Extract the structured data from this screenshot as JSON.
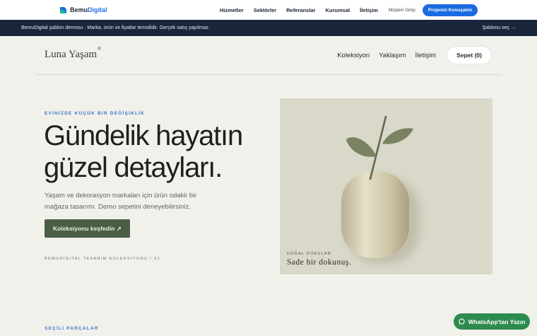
{
  "agency": {
    "logo_main": "Bemu",
    "logo_accent": "Digital",
    "nav": [
      "Hizmetler",
      "Sektörler",
      "Referanslar",
      "Kurumsal",
      "İletişim"
    ],
    "login": "Müşteri Girişi",
    "cta": "Projenizi Konuşalım",
    "brand_color": "#1a6be0"
  },
  "demo_bar": {
    "notice": "BemuDigital şablon demosu · Marka, ürün ve fiyatlar temsilidir. Gerçek satış yapılmaz.",
    "select_template": "Şablonu seç →"
  },
  "store": {
    "logo": "Luna Yaşam",
    "registered": "®",
    "nav": [
      "Koleksiyon",
      "Yaklaşım",
      "İletişim"
    ],
    "cart": "Sepet (0)"
  },
  "hero": {
    "eyebrow": "EVİNİZDE KÜÇÜK BİR DEĞİŞİKLİK",
    "title": "Gündelik hayatın güzel detayları.",
    "text": "Yaşam ve dekorasyon markaları için ürün odaklı bir mağaza tasarımı. Demo sepetini deneyebilirsiniz.",
    "button": "Koleksiyonu keşfedin ↗",
    "caption": "BEMUDIGITAL TASARIM KOLEKSİYONU / 01",
    "image_eyebrow": "DOĞAL DOKULAR",
    "image_caption": "Sade bir dokunuş.",
    "accent_color": "#4a5e45"
  },
  "section": {
    "label": "SEÇİLİ PARÇALAR"
  },
  "whatsapp": {
    "label": "WhatsApp'tan Yazın",
    "color": "#2e8b4e",
    "icon": "whatsapp-icon"
  }
}
